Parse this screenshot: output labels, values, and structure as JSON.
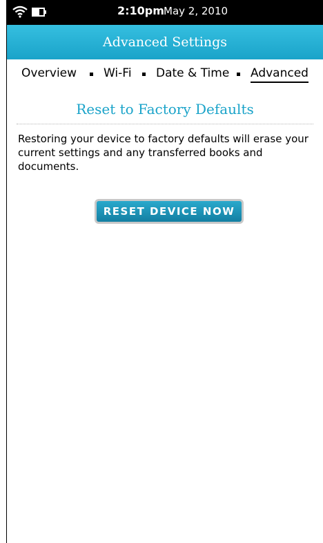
{
  "status_bar": {
    "time": "2:10pm",
    "date": "May 2, 2010",
    "icons": [
      "wifi-icon",
      "battery-icon"
    ]
  },
  "header": {
    "title": "Advanced Settings"
  },
  "tabs": [
    {
      "label": "Overview",
      "active": false
    },
    {
      "label": "Wi-Fi",
      "active": false
    },
    {
      "label": "Date & Time",
      "active": false
    },
    {
      "label": "Advanced",
      "active": true
    }
  ],
  "section": {
    "title": "Reset to Factory Defaults",
    "description": "Restoring your device to factory defaults will erase your current settings and any transferred books and documents.",
    "button_label": "RESET DEVICE NOW"
  },
  "colors": {
    "accent": "#1aa3c9",
    "status_bar": "#000000",
    "button": "#137fa2"
  }
}
